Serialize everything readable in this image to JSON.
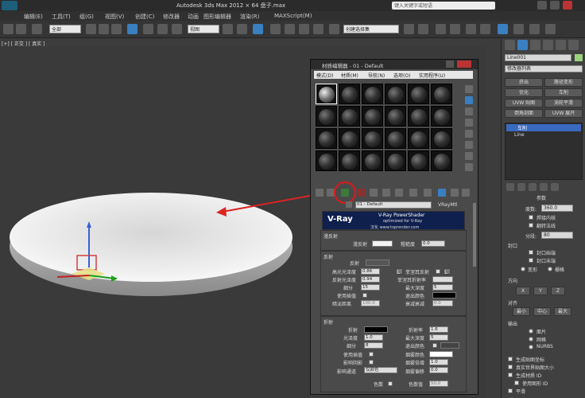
{
  "titlebar": {
    "title": "Autodesk 3ds Max  2012 × 64    盘子.max",
    "help_placeholder": "键入关键字或短语"
  },
  "menubar": {
    "items": [
      "编辑(E)",
      "工具(T)",
      "组(G)",
      "视图(V)",
      "创建(C)",
      "修改器",
      "动画",
      "图形编辑器",
      "渲染(R)",
      "MAXScript(M)"
    ]
  },
  "toolbar": {
    "selection_filter": "全部",
    "view_dropdown": "视图",
    "named_selection": "创建选择集"
  },
  "viewport": {
    "label": "[+] [ 正交 ] [ 真实 ]"
  },
  "command_panel": {
    "object_name": "Line001",
    "modifier_list": "修改器列表",
    "buttons": [
      "挤出",
      "路径变形",
      "优化",
      "车削",
      "UVW 贴图",
      "涡轮平滑",
      "倒角剖面",
      "UVW 展开"
    ],
    "stack": [
      "车削",
      "Line"
    ],
    "params_title": "参数",
    "degrees_label": "度数:",
    "degrees_value": "360.0",
    "weld_core": "焊接内核",
    "flip_normals": "翻转法线",
    "segments_label": "分段:",
    "segments_value": "80",
    "capping_title": "封口",
    "cap_start": "封口始端",
    "cap_end": "封口末端",
    "morph": "变形",
    "grid": "栅格",
    "direction_title": "方向",
    "dir_x": "X",
    "dir_y": "Y",
    "dir_z": "Z",
    "align_title": "对齐",
    "align_min": "最小",
    "align_center": "中心",
    "align_max": "最大",
    "output_title": "输出",
    "out_patch": "面片",
    "out_mesh": "网格",
    "out_nurbs": "NURBS",
    "gen_map_coords": "生成贴图坐标",
    "real_world": "真实世界贴图大小",
    "gen_mat_ids": "生成材质 ID",
    "use_shape_ids": "使用图形 ID",
    "smooth": "平滑"
  },
  "material_editor": {
    "title": "材质编辑器 - 01 - Default",
    "menu": [
      "模式(D)",
      "材质(M)",
      "导航(N)",
      "选项(O)",
      "实用程序(U)"
    ],
    "material_name": "01 - Default",
    "material_type": "VRayMtl",
    "vray_logo": "V-Ray",
    "vray_banner_line1": "V-Ray PowerShader",
    "vray_banner_line2": "optimized for V-Ray",
    "vray_banner_line3": "汉化 www.toprender.com",
    "basic_title": "漫反射",
    "diffuse_label": "漫反射",
    "roughness_label": "粗糙度",
    "roughness_value": "0.0",
    "reflection_title": "反射",
    "reflect_label": "反射",
    "hilight_gloss": "高光光泽度",
    "hilight_value": "0.86",
    "refl_gloss": "反射光泽度",
    "refl_gloss_value": "0.94",
    "subdivs": "细分",
    "subdivs_value": "15",
    "use_interp": "使用插值",
    "dim_dist": "暗淡距离",
    "dim_value": "100.0",
    "fresnel": "菲涅耳反射",
    "fresnel_ior": "菲涅耳折射率",
    "max_depth": "最大深度",
    "max_depth_value": "5",
    "exit_color": "退出颜色",
    "dim_falloff": "衰减衰减",
    "dim_falloff_value": "0.0",
    "L": "L",
    "refraction_title": "折射",
    "refract_label": "折射",
    "ior_label": "折射率",
    "ior_value": "1.6",
    "r_gloss": "光泽度",
    "r_gloss_value": "1.0",
    "r_max_depth": "最大深度",
    "r_max_depth_value": "5",
    "r_subdivs": "细分",
    "r_subdivs_value": "8",
    "r_exit_color": "退出颜色",
    "r_use_interp": "使用插值",
    "fog_color": "烟雾颜色",
    "affect_shadows": "影响阴影",
    "fog_mult": "烟雾倍增",
    "fog_mult_value": "1.0",
    "affect_channels": "影响通道",
    "affect_channels_value": "仅颜色",
    "fog_bias": "烟雾偏移",
    "fog_bias_value": "0.0",
    "dispersion": "色散",
    "abbe": "色散值",
    "abbe_value": "50.0"
  }
}
